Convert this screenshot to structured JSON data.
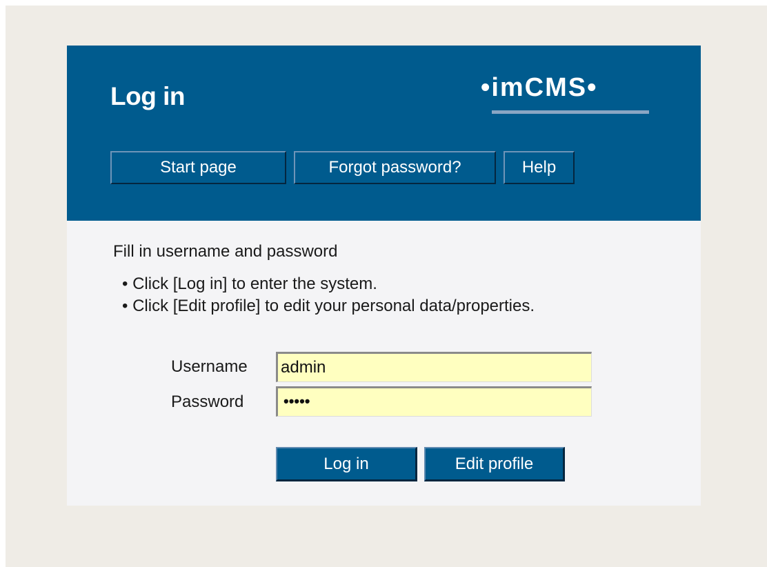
{
  "header": {
    "title": "Log in",
    "logo_text": "imCMS"
  },
  "nav": {
    "start_page": "Start page",
    "forgot_password": "Forgot password?",
    "help": "Help"
  },
  "content": {
    "intro": "Fill in username and password",
    "bullets": [
      "• Click [Log in] to enter the system.",
      "• Click [Edit profile] to edit your personal data/properties."
    ]
  },
  "form": {
    "username_label": "Username",
    "username_value": "admin",
    "password_label": "Password",
    "password_mask": "•••••",
    "login_label": "Log in",
    "edit_profile_label": "Edit profile"
  },
  "colors": {
    "header_blue": "#005b8e",
    "page_background": "#efece6",
    "panel_background": "#f4f4f6",
    "input_background": "#ffffc0"
  }
}
